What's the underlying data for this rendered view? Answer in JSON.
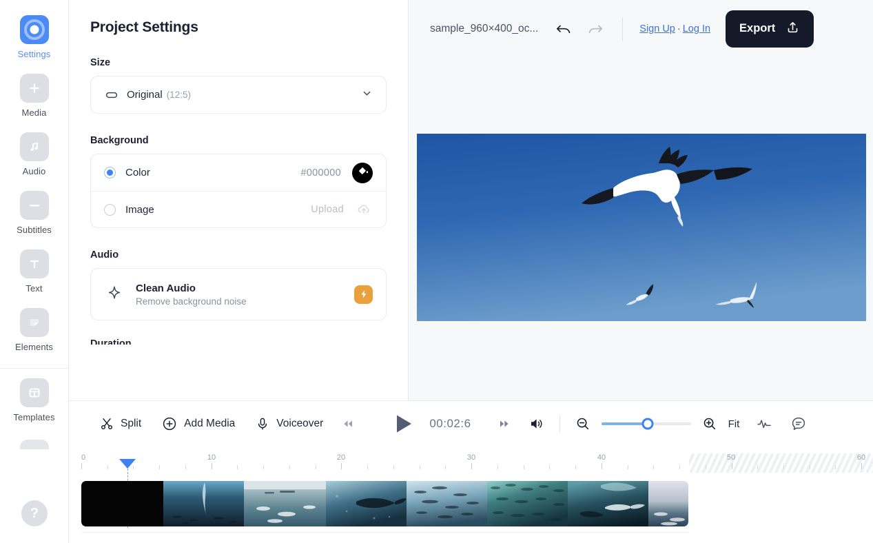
{
  "sidebar": {
    "items": [
      {
        "label": "Settings",
        "icon": "settings-rings-icon",
        "active": true
      },
      {
        "label": "Media",
        "icon": "plus-icon",
        "active": false
      },
      {
        "label": "Audio",
        "icon": "music-note-icon",
        "active": false
      },
      {
        "label": "Subtitles",
        "icon": "subtitles-icon",
        "active": false
      },
      {
        "label": "Text",
        "icon": "text-t-icon",
        "active": false
      },
      {
        "label": "Elements",
        "icon": "elements-shape-icon",
        "active": false
      },
      {
        "label": "Templates",
        "icon": "templates-grid-icon",
        "active": false
      }
    ],
    "help_label": "?"
  },
  "panel": {
    "title": "Project Settings",
    "size": {
      "section_label": "Size",
      "icon": "aspect-ratio-icon",
      "value": "Original",
      "ratio": "(12:5)",
      "chevron": "chevron-down-icon"
    },
    "background": {
      "section_label": "Background",
      "color_option": {
        "label": "Color",
        "value": "#000000",
        "selected": true,
        "swatch_color": "#000000",
        "swatch_icon": "paint-bucket-icon"
      },
      "image_option": {
        "label": "Image",
        "value": "Upload",
        "selected": false,
        "icon": "cloud-upload-icon"
      }
    },
    "audio": {
      "section_label": "Audio",
      "icon": "sparkle-icon",
      "title": "Clean Audio",
      "subtitle": "Remove background noise",
      "badge_icon": "lightning-bolt-icon",
      "badge_color": "#e8a13c"
    },
    "next_section_label": "Duration"
  },
  "topbar": {
    "filename": "sample_960×400_oc...",
    "undo_icon": "undo-arrow-icon",
    "redo_icon": "redo-arrow-icon",
    "sign_up": "Sign Up",
    "separator": "·",
    "log_in": "Log In",
    "export_label": "Export",
    "export_icon": "share-upload-icon",
    "export_bg": "#141a2a"
  },
  "toolbar": {
    "split_label": "Split",
    "split_icon": "scissors-icon",
    "add_media_label": "Add Media",
    "add_media_icon": "plus-circle-icon",
    "voiceover_label": "Voiceover",
    "voiceover_icon": "microphone-icon",
    "seek_back_icon": "rewind-icon",
    "play_icon": "play-icon",
    "timecode": "00:02:6",
    "seek_forward_icon": "fast-forward-icon",
    "volume_icon": "speaker-on-icon",
    "zoom_out_icon": "magnifier-minus-icon",
    "zoom_in_icon": "magnifier-plus-icon",
    "zoom_value": 52,
    "fit_label": "Fit",
    "waveform_icon": "audio-waveform-icon",
    "captions_icon": "caption-bubble-icon",
    "accent_color": "#3d82f0"
  },
  "timeline": {
    "tick_labels": [
      "0",
      "10",
      "20",
      "30",
      "40",
      "50",
      "60"
    ],
    "playhead_position_seconds": 2.6,
    "clips": [
      {
        "name": "clip-1",
        "type": "black",
        "width": 119
      },
      {
        "name": "clip-2",
        "type": "thumbnail",
        "width": 117
      },
      {
        "name": "clip-3",
        "type": "thumbnail",
        "width": 119
      },
      {
        "name": "clip-4",
        "type": "thumbnail",
        "width": 117
      },
      {
        "name": "clip-5",
        "type": "thumbnail",
        "width": 117
      },
      {
        "name": "clip-6",
        "type": "thumbnail",
        "width": 117
      },
      {
        "name": "clip-7",
        "type": "thumbnail",
        "width": 117
      },
      {
        "name": "clip-8",
        "type": "thumbnail",
        "width": 58
      }
    ]
  },
  "preview": {
    "alt": "Gannet seabird gliding against a clear blue sky with two smaller birds below"
  }
}
